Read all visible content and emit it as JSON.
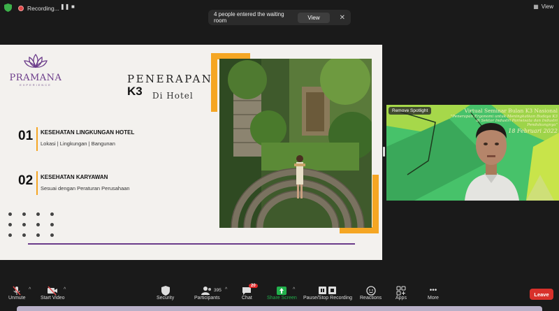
{
  "topbar": {
    "recording_label": "Recording...",
    "view_label": "View"
  },
  "notification": {
    "message": "4 people entered the waiting room",
    "view_button": "View"
  },
  "slide": {
    "logo_name": "PRAMANA",
    "logo_sub": "EXPERIENCE",
    "title_line1": "PENERAPAN",
    "title_line2": "K3",
    "title_line3": "Di Hotel",
    "items": [
      {
        "number": "01",
        "heading": "KESEHATAN LINGKUNGAN HOTEL",
        "detail": "Lokasi | Lingkungan | Bangunan"
      },
      {
        "number": "02",
        "heading": "KESEHATAN KARYAWAN",
        "detail": "Sesuai dengan Peraturan Perusahaan"
      }
    ]
  },
  "video": {
    "spotlight_button": "Remove Spotlight",
    "banner_line1": "Virtual Seminar Bulan K3 Nasional",
    "banner_line2": "\"Penerapan Ergonomi untuk Meningkatkan Budaya K3",
    "banner_line3": "di Sektor Industri Pariwisata dan Industri",
    "banner_line4": "Pendukungnya\"",
    "banner_line5": "18 Februari 2022"
  },
  "toolbar": {
    "unmute": "Unmute",
    "start_video": "Start Video",
    "security": "Security",
    "participants": "Participants",
    "participants_count": "395",
    "chat": "Chat",
    "chat_badge": "20",
    "share_screen": "Share Screen",
    "pause_recording": "Pause/Stop Recording",
    "reactions": "Reactions",
    "apps": "Apps",
    "more": "More",
    "leave": "Leave"
  },
  "colors": {
    "accent_orange": "#f5a623",
    "brand_purple": "#6b3b8a",
    "leave_red": "#d8312b",
    "share_green": "#22b14c"
  }
}
